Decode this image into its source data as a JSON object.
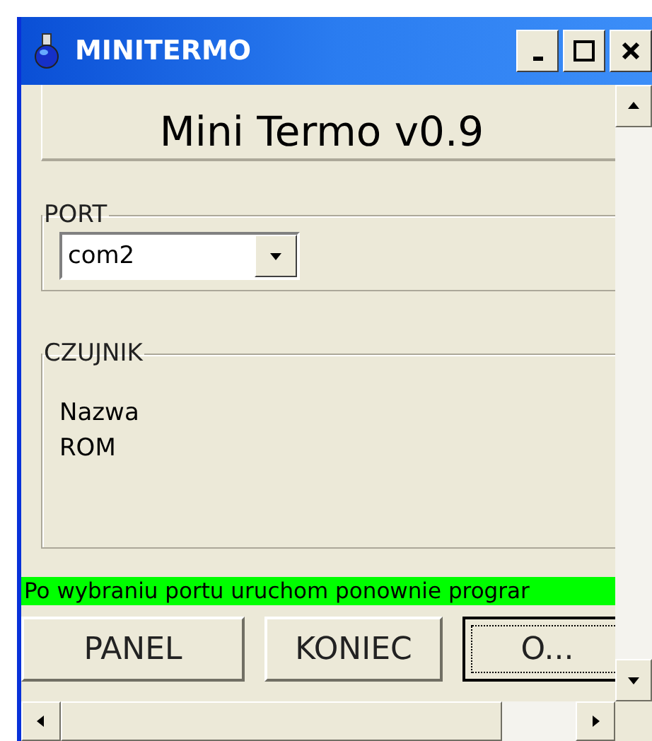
{
  "window": {
    "title": "MINITERMO"
  },
  "heading": "Mini Termo v0.9",
  "port_group": {
    "label": "PORT",
    "value": "com2"
  },
  "sensor_group": {
    "label": "CZUJNIK",
    "fields": [
      "Nazwa",
      "ROM"
    ]
  },
  "status": "Po wybraniu portu uruchom ponownie prograr",
  "buttons": [
    {
      "label": "PANEL",
      "focused": false
    },
    {
      "label": "KONIEC",
      "focused": false
    },
    {
      "label": "O...",
      "focused": true
    }
  ]
}
